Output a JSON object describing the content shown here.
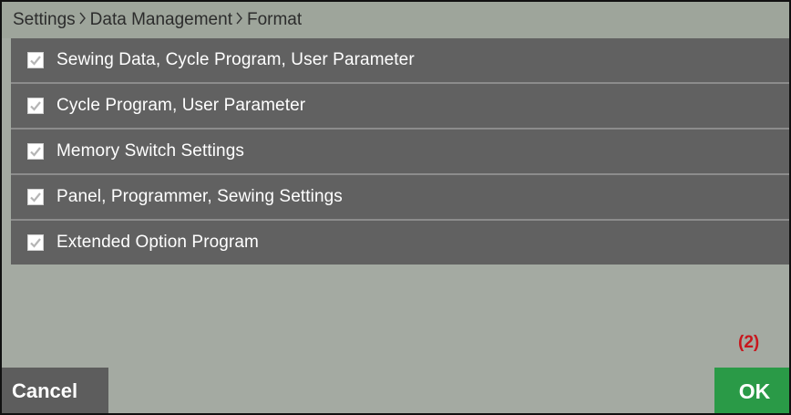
{
  "breadcrumb": {
    "items": [
      "Settings",
      "Data Management",
      "Format"
    ]
  },
  "options": [
    {
      "label": "Sewing Data, Cycle Program, User Parameter",
      "checked": true
    },
    {
      "label": "Cycle Program, User Parameter",
      "checked": true
    },
    {
      "label": "Memory Switch Settings",
      "checked": true
    },
    {
      "label": "Panel, Programmer, Sewing Settings",
      "checked": true
    },
    {
      "label": "Extended Option Program",
      "checked": true
    }
  ],
  "annotation": "(2)",
  "buttons": {
    "cancel_label": "Cancel",
    "ok_label": "OK"
  },
  "icons": {
    "breadcrumb_separator": "chevron-right-icon",
    "checkbox": "checkmark-icon"
  },
  "colors": {
    "background": "#a4aaa2",
    "row_background": "#616161",
    "cancel_background": "#5d5d5d",
    "ok_background": "#2a9a47",
    "annotation": "#c8171d"
  }
}
